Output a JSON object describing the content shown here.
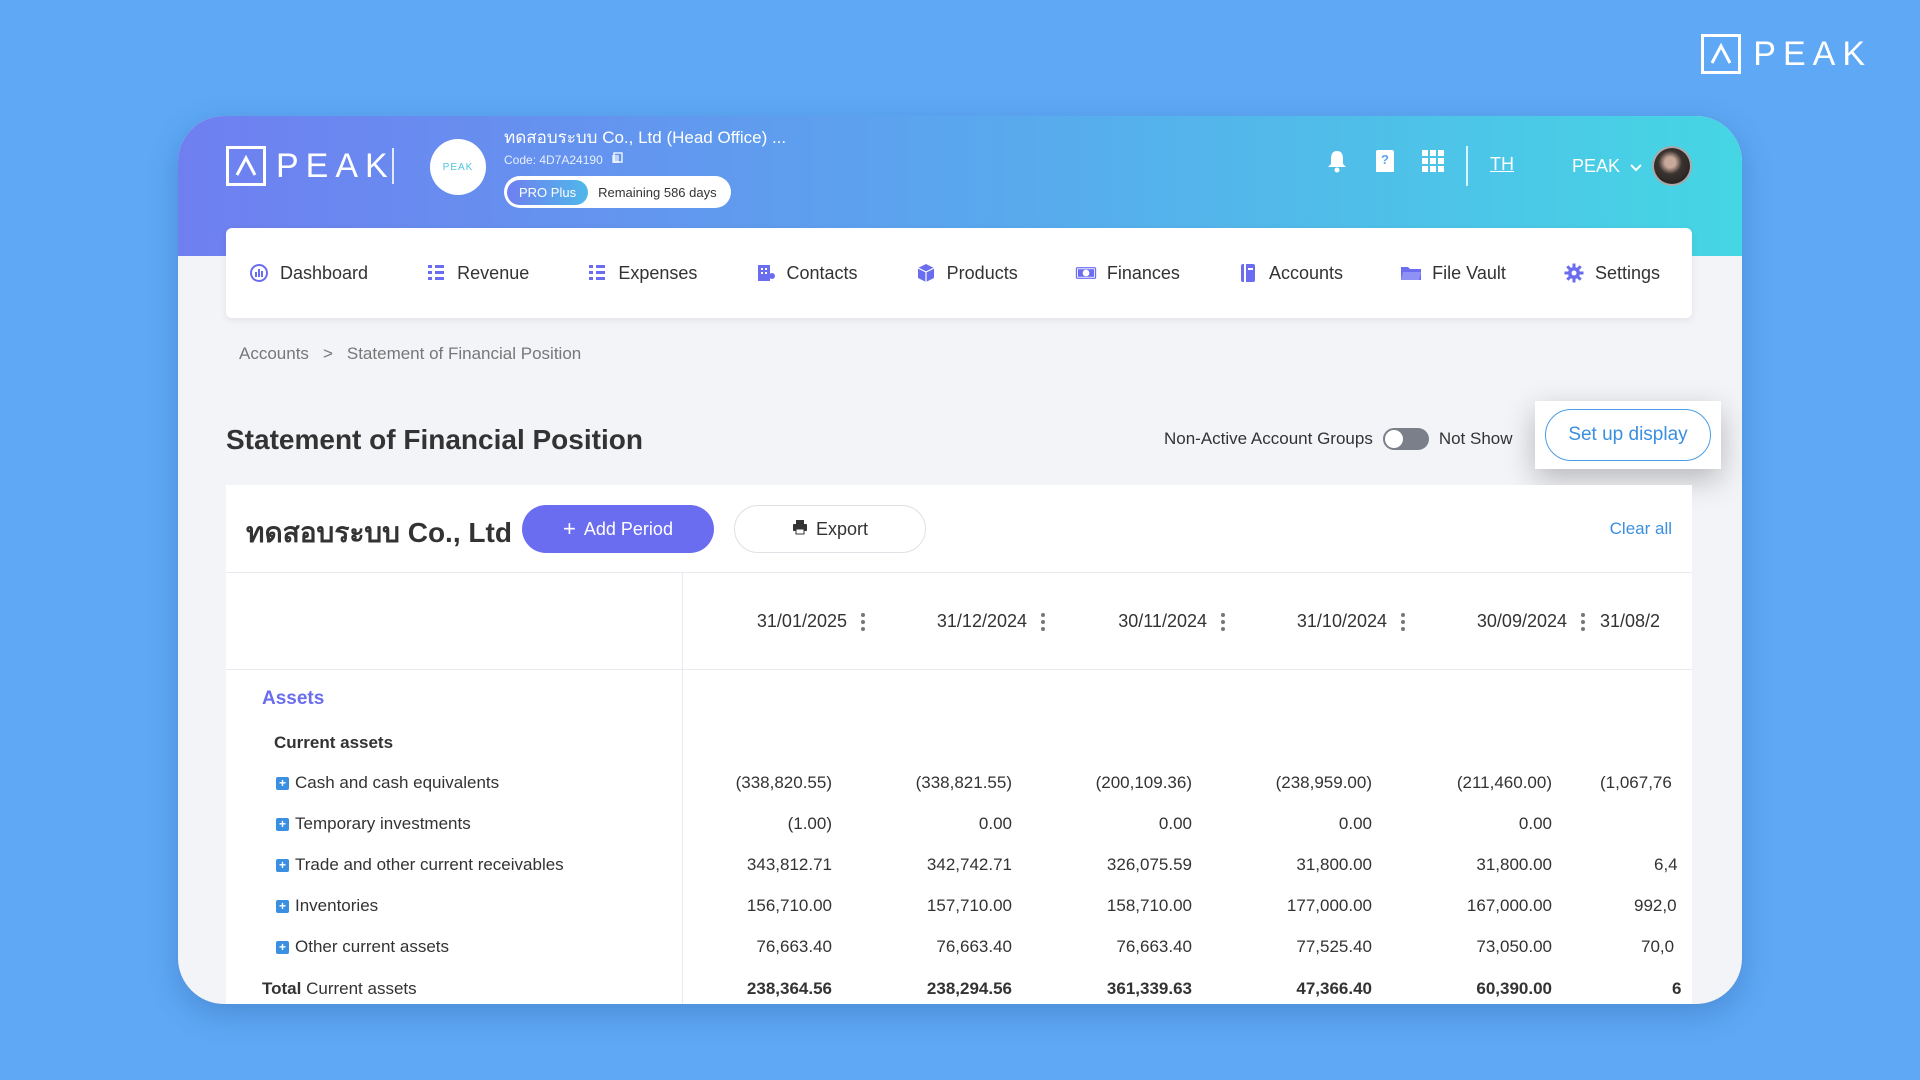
{
  "brand": {
    "name": "PEAK"
  },
  "header": {
    "company_name": "ทดสอบระบบ Co., Ltd (Head Office) ...",
    "company_code": "Code: 4D7A24190",
    "plan_label": "PRO Plus",
    "remaining": "Remaining 586 days",
    "avatar_text": "PEAK",
    "language": "TH",
    "user_name": "PEAK"
  },
  "nav": {
    "items": [
      {
        "label": "Dashboard",
        "icon": "dashboard-icon"
      },
      {
        "label": "Revenue",
        "icon": "revenue-icon"
      },
      {
        "label": "Expenses",
        "icon": "expenses-icon"
      },
      {
        "label": "Contacts",
        "icon": "contacts-icon"
      },
      {
        "label": "Products",
        "icon": "box-icon"
      },
      {
        "label": "Finances",
        "icon": "money-icon"
      },
      {
        "label": "Accounts",
        "icon": "ledger-icon"
      },
      {
        "label": "File Vault",
        "icon": "folder-icon"
      },
      {
        "label": "Settings",
        "icon": "gear-icon"
      }
    ]
  },
  "breadcrumb": {
    "parent": "Accounts",
    "separator": ">",
    "current": "Statement of Financial Position"
  },
  "page": {
    "title": "Statement of Financial Position",
    "toggle_label": "Non-Active Account Groups",
    "toggle_state": "Not Show",
    "setup_button": "Set up display"
  },
  "card": {
    "company": "ทดสอบระบบ Co., Ltd",
    "add_period": "Add Period",
    "export": "Export",
    "clear_all": "Clear all"
  },
  "table": {
    "columns": [
      "31/01/2025",
      "31/12/2024",
      "30/11/2024",
      "31/10/2024",
      "30/09/2024",
      "31/08/2"
    ],
    "section": "Assets",
    "subsection": "Current assets",
    "rows": [
      {
        "label": "Cash and cash equivalents",
        "values": [
          "(338,820.55)",
          "(338,821.55)",
          "(200,109.36)",
          "(238,959.00)",
          "(211,460.00)",
          "(1,067,76"
        ]
      },
      {
        "label": "Temporary investments",
        "values": [
          "(1.00)",
          "0.00",
          "0.00",
          "0.00",
          "0.00",
          ""
        ]
      },
      {
        "label": "Trade and other current receivables",
        "values": [
          "343,812.71",
          "342,742.71",
          "326,075.59",
          "31,800.00",
          "31,800.00",
          "6,4"
        ]
      },
      {
        "label": "Inventories",
        "values": [
          "156,710.00",
          "157,710.00",
          "158,710.00",
          "177,000.00",
          "167,000.00",
          "992,0"
        ]
      },
      {
        "label": "Other current assets",
        "values": [
          "76,663.40",
          "76,663.40",
          "76,663.40",
          "77,525.40",
          "73,050.00",
          "70,0"
        ]
      }
    ],
    "total": {
      "prefix": "Total",
      "label": "Current assets",
      "values": [
        "238,364.56",
        "238,294.56",
        "361,339.63",
        "47,366.40",
        "60,390.00",
        "6"
      ]
    }
  }
}
